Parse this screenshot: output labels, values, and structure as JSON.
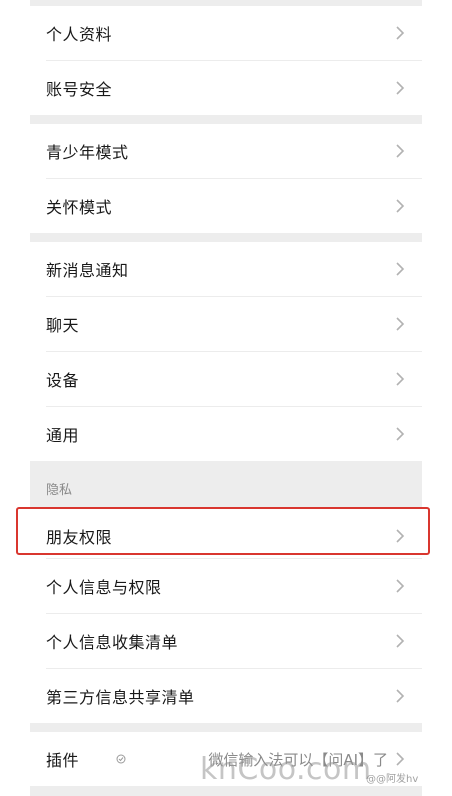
{
  "groups": {
    "account": [
      "个人资料",
      "账号安全"
    ],
    "modes": [
      "青少年模式",
      "关怀模式"
    ],
    "general": [
      "新消息通知",
      "聊天",
      "设备",
      "通用"
    ],
    "privacy_header": "隐私",
    "privacy": [
      "朋友权限",
      "个人信息与权限",
      "个人信息收集清单",
      "第三方信息共享清单"
    ],
    "plugins": {
      "label": "插件",
      "value": "微信输入法可以【问AI】了"
    }
  },
  "watermark": {
    "main": "knCoo.com",
    "small": "@@阿发hv"
  },
  "colors": {
    "separator_bg": "#ededed",
    "highlight_border": "#d9362f",
    "text_primary": "#191919",
    "text_secondary": "#8a8a8a"
  },
  "icons": {
    "chevron": "chevron-right-icon",
    "plugin_status": "circle-status-icon"
  }
}
